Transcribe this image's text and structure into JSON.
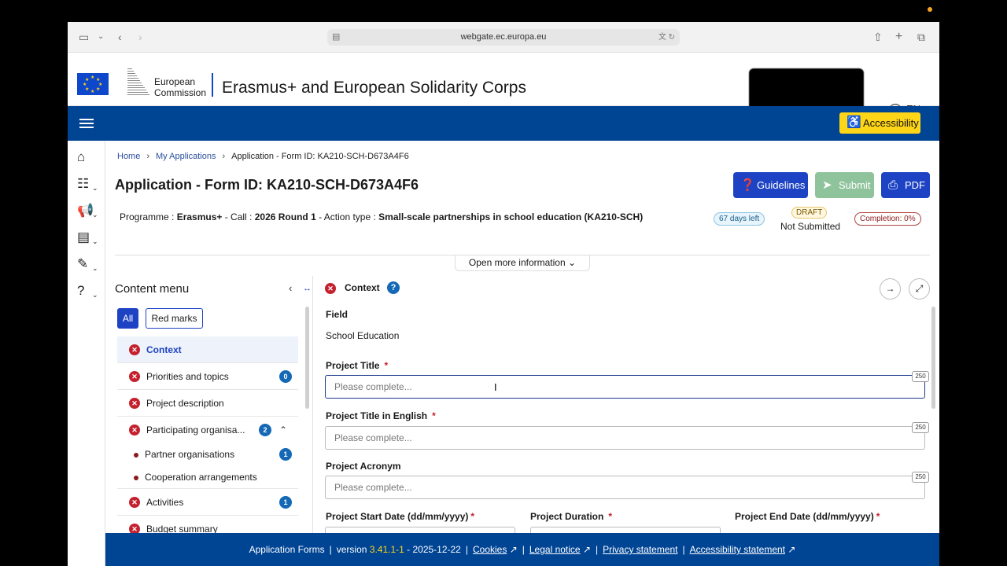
{
  "browser": {
    "url": "webgate.ec.europa.eu"
  },
  "header": {
    "org_line1": "European",
    "org_line2": "Commission",
    "site_title": "Erasmus+ and European Solidarity Corps",
    "language": "EN",
    "accessibility_label": "Accessibility"
  },
  "breadcrumb": {
    "home": "Home",
    "my_applications": "My Applications",
    "current": "Application - Form ID: KA210-SCH-D673A4F6"
  },
  "page": {
    "title": "Application - Form ID: KA210-SCH-D673A4F6",
    "guidelines_label": "Guidelines",
    "submit_label": "Submit",
    "pdf_label": "PDF",
    "programme_label": "Programme : ",
    "programme": "Erasmus+",
    "call_label": " - Call : ",
    "call": "2026 Round 1",
    "action_label": " - Action type : ",
    "action_type": "Small-scale partnerships in school education (KA210-SCH)",
    "days_left": "67 days left",
    "draft": "DRAFT",
    "status": "Not Submitted",
    "completion": "Completion: 0%",
    "open_more": "Open more information"
  },
  "content_menu": {
    "title": "Content menu",
    "filter_all": "All",
    "filter_red": "Red marks",
    "items": [
      {
        "label": "Context",
        "count": ""
      },
      {
        "label": "Priorities and topics",
        "count": "0"
      },
      {
        "label": "Project description",
        "count": ""
      },
      {
        "label": "Participating organisa...",
        "count": "2"
      },
      {
        "label": "Partner organisations",
        "count": "1"
      },
      {
        "label": "Cooperation arrangements",
        "count": ""
      },
      {
        "label": "Activities",
        "count": "1"
      },
      {
        "label": "Budget summary",
        "count": ""
      }
    ]
  },
  "form": {
    "section_title": "Context",
    "field_label": "Field",
    "field_value": "School Education",
    "project_title_label": "Project Title",
    "project_title_en_label": "Project Title in English",
    "project_acronym_label": "Project Acronym",
    "placeholder": "Please complete...",
    "limit": "250",
    "start_date_label": "Project Start Date (dd/mm/yyyy)",
    "duration_label": "Project Duration",
    "end_date_label": "Project End Date (dd/mm/yyyy)",
    "required_mark": "*"
  },
  "footer": {
    "app": "Application Forms",
    "version_label": "version ",
    "version": "3.41.1-1",
    "date": " - 2025-12-22",
    "cookies": "Cookies",
    "legal": "Legal notice",
    "privacy": "Privacy statement",
    "accessibility": "Accessibility statement"
  }
}
